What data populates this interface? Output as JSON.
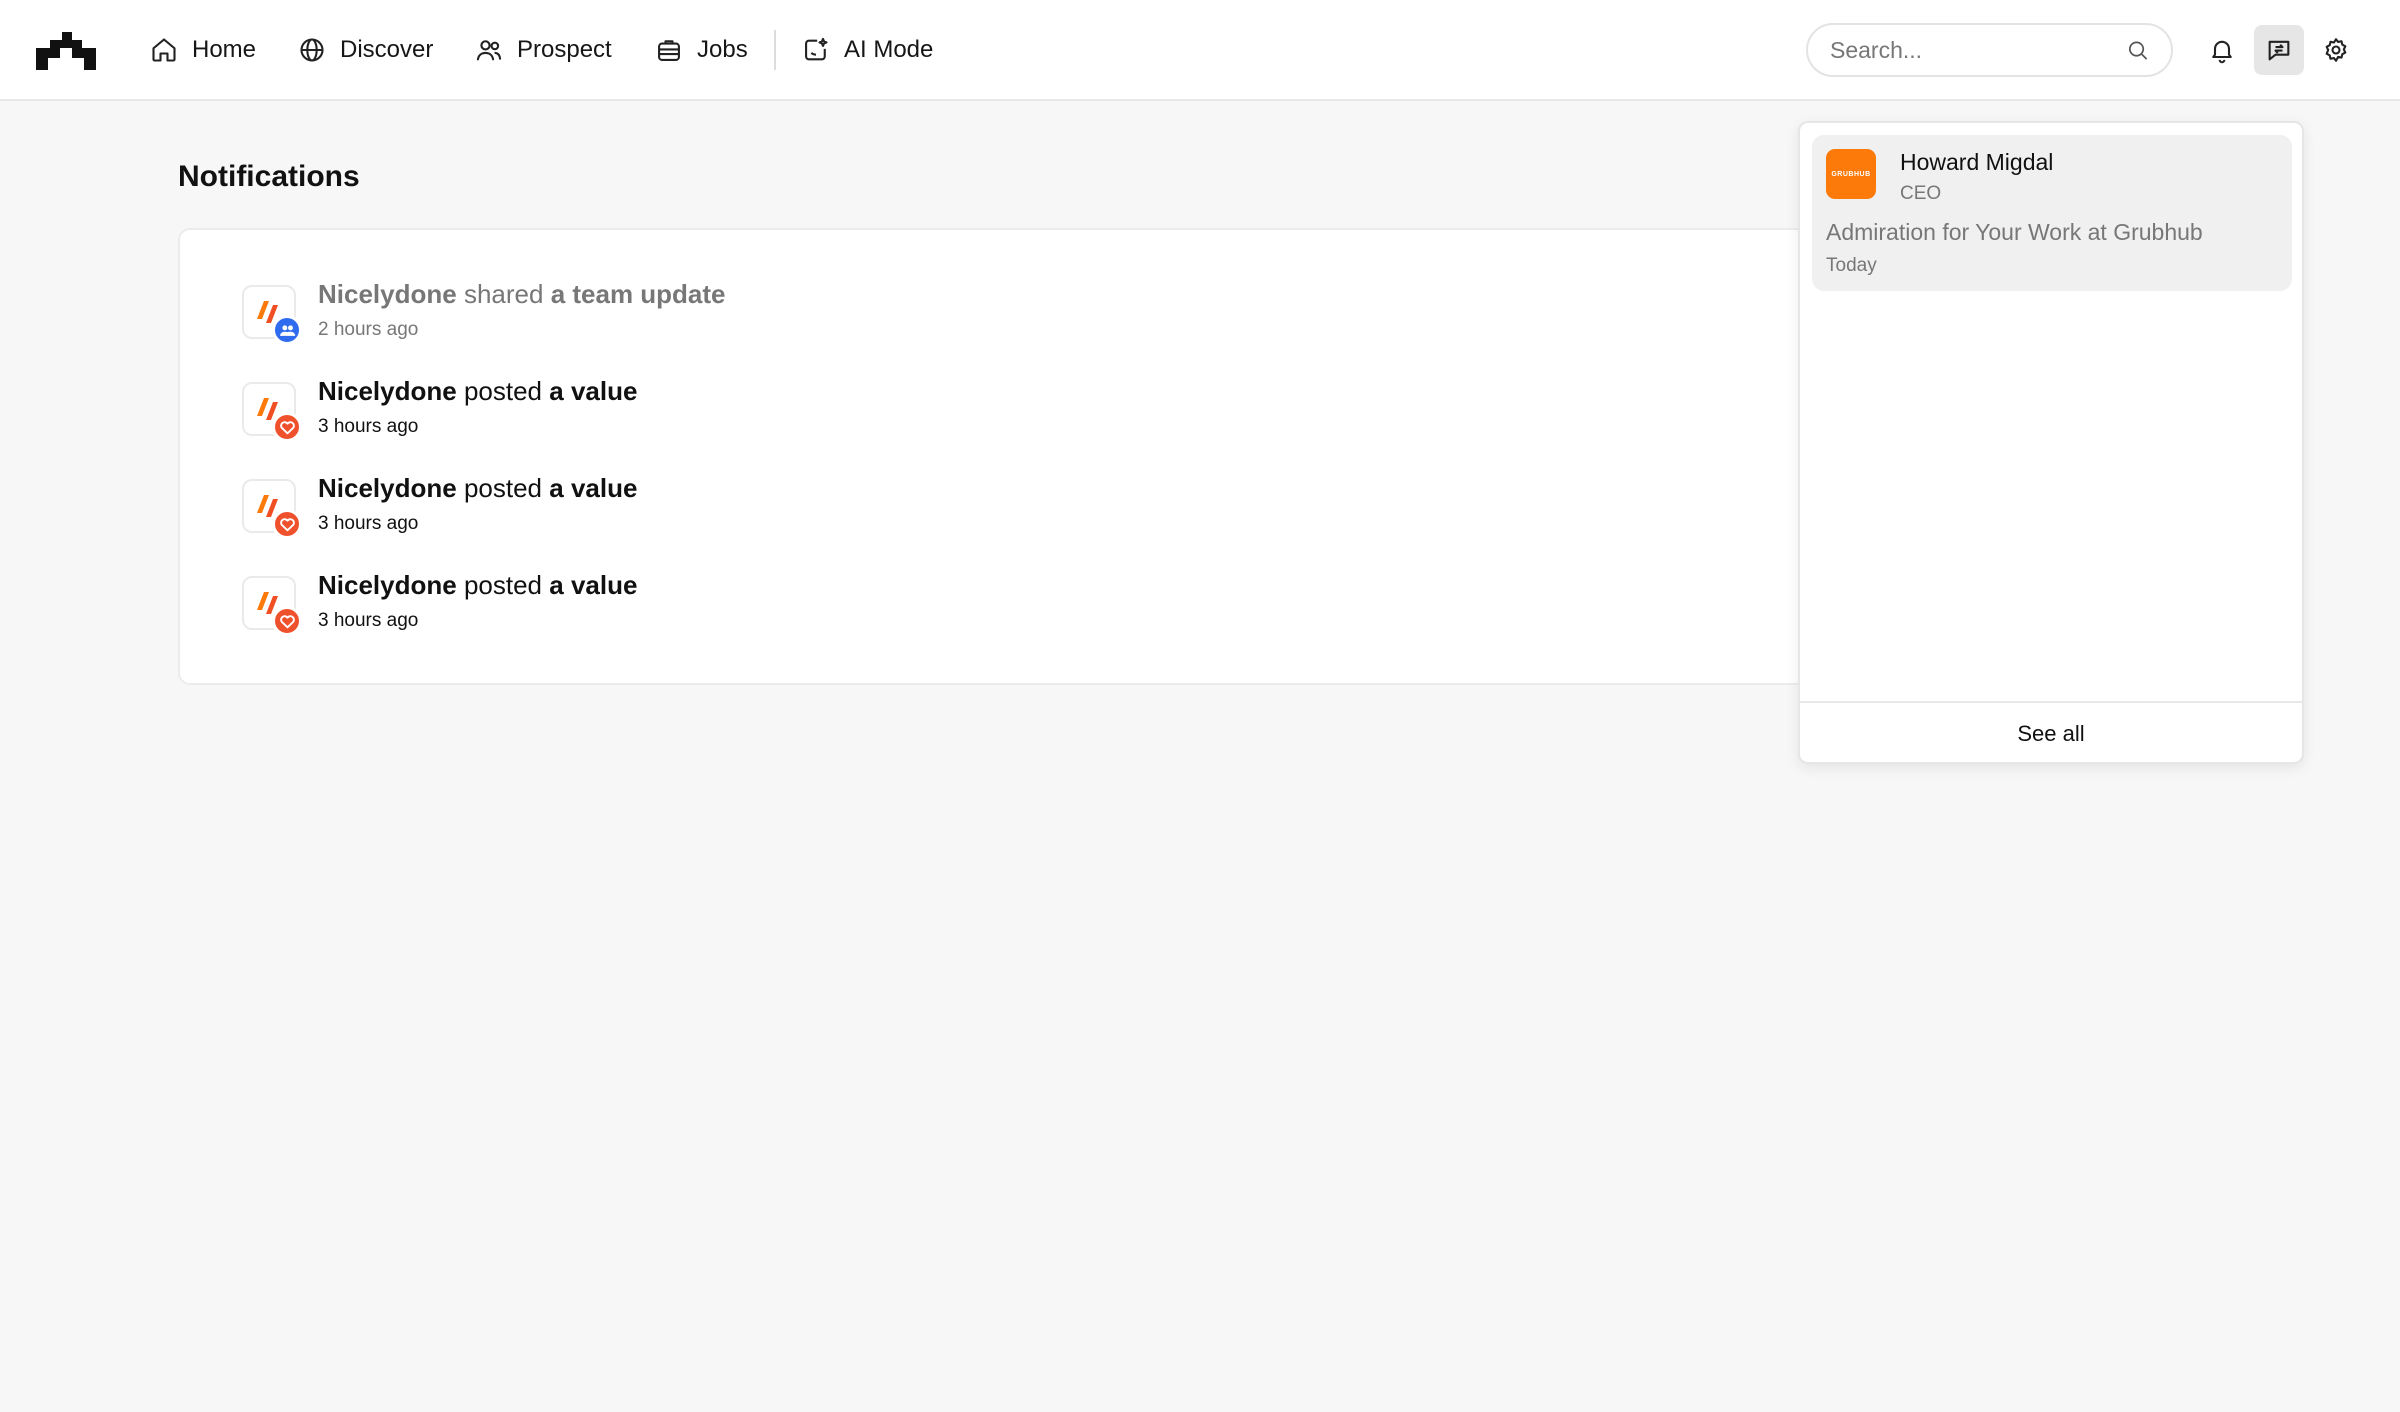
{
  "nav": {
    "items": [
      {
        "label": "Home",
        "icon": "home-icon"
      },
      {
        "label": "Discover",
        "icon": "globe-icon"
      },
      {
        "label": "Prospect",
        "icon": "users-icon"
      },
      {
        "label": "Jobs",
        "icon": "briefcase-icon"
      },
      {
        "label": "AI Mode",
        "icon": "ai-sparkle-icon"
      }
    ],
    "search_placeholder": "Search...",
    "right_icons": [
      "bell-icon",
      "messages-icon",
      "gear-icon"
    ]
  },
  "page": {
    "title": "Notifications"
  },
  "notifications": [
    {
      "actor": "Nicelydone",
      "verb": "shared",
      "object": "a team update",
      "time": "2 hours ago",
      "badge": "team-icon",
      "read": true
    },
    {
      "actor": "Nicelydone",
      "verb": "posted",
      "object": "a value",
      "time": "3 hours ago",
      "badge": "heart-icon",
      "read": false
    },
    {
      "actor": "Nicelydone",
      "verb": "posted",
      "object": "a value",
      "time": "3 hours ago",
      "badge": "heart-icon",
      "read": false
    },
    {
      "actor": "Nicelydone",
      "verb": "posted",
      "object": "a value",
      "time": "3 hours ago",
      "badge": "heart-icon",
      "read": false
    }
  ],
  "messages_dropdown": {
    "items": [
      {
        "name": "Howard Migdal",
        "role": "CEO",
        "subject": "Admiration for Your Work at Grubhub",
        "date": "Today",
        "logo_text": "GRUBHUB"
      }
    ],
    "see_all_label": "See all"
  },
  "colors": {
    "accent_orange": "#fb7a0a",
    "team_badge": "#2f6bef",
    "value_badge": "#f0512d"
  }
}
